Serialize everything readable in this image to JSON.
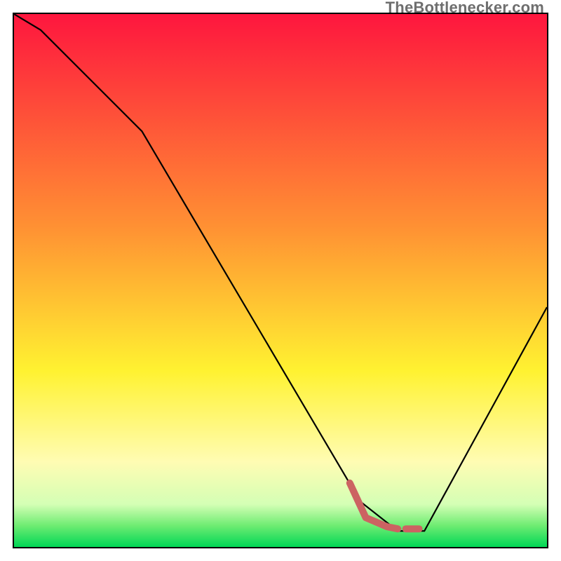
{
  "attribution": "TheBottlenecker.com",
  "colors": {
    "top": "#fe163e",
    "orange": "#ff9133",
    "yellow": "#fff231",
    "pale_yellow": "#fffcb3",
    "pale_green": "#d4ffb5",
    "green_mid": "#6eec72",
    "green": "#00d756",
    "curve": "#000000",
    "short_segment": "#cc6362"
  },
  "chart_data": {
    "type": "line",
    "title": "",
    "xlabel": "",
    "ylabel": "",
    "xlim": [
      0,
      100
    ],
    "ylim": [
      0,
      100
    ],
    "series": [
      {
        "name": "main_curve",
        "x": [
          0,
          5,
          24,
          65,
          72,
          77,
          100
        ],
        "values": [
          100,
          97,
          78,
          8.5,
          3,
          3,
          45
        ]
      },
      {
        "name": "short_segment",
        "x": [
          63,
          66,
          70,
          72,
          73.5,
          75,
          76
        ],
        "values": [
          12,
          5.5,
          3.8,
          3.4,
          3.4,
          3.4,
          3.4
        ],
        "broken_after_index": 3
      }
    ],
    "annotations": []
  }
}
